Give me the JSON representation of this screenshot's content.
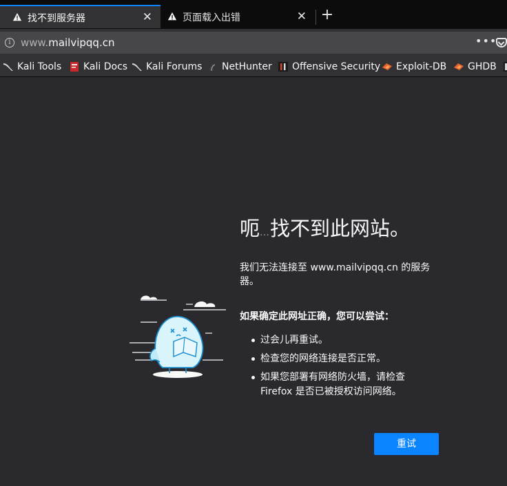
{
  "tabs": [
    {
      "title": "找不到服务器",
      "close": "✕",
      "icon": "warning-icon",
      "active": true
    },
    {
      "title": "页面载入出错",
      "close": "✕",
      "icon": "warning-icon",
      "active": false
    }
  ],
  "new_tab": "+",
  "urlbar": {
    "prefix": "www.",
    "host": "mailvipqq.cn",
    "info_icon": "i",
    "more_label": "•••"
  },
  "bookmarks": [
    {
      "label": "Kali Tools",
      "icon": "kali-dragon-icon"
    },
    {
      "label": "Kali Docs",
      "icon": "kali-docs-icon"
    },
    {
      "label": "Kali Forums",
      "icon": "kali-dragon-icon"
    },
    {
      "label": "NetHunter",
      "icon": "nethunter-icon"
    },
    {
      "label": "Offensive Security",
      "icon": "offsec-icon"
    },
    {
      "label": "Exploit-DB",
      "icon": "exploit-db-icon"
    },
    {
      "label": "GHDB",
      "icon": "ghdb-icon"
    }
  ],
  "error": {
    "heading_start": "呃",
    "heading_ellipsis": "…",
    "heading_end": "找不到此网站。",
    "description": "我们无法连接至 www.mailvipqq.cn 的服务器。",
    "subheading": "如果确定此网址正确，您可以尝试：",
    "tips": [
      "过会儿再重试。",
      "检查您的网络连接是否正常。",
      "如果您部署有网络防火墙，请检查 Firefox 是否已被授权访问网络。"
    ],
    "retry_label": "重试"
  },
  "colors": {
    "accent": "#0a84ff",
    "background": "#2a2a2e",
    "chrome": "#323234",
    "urlbar": "#474749"
  }
}
